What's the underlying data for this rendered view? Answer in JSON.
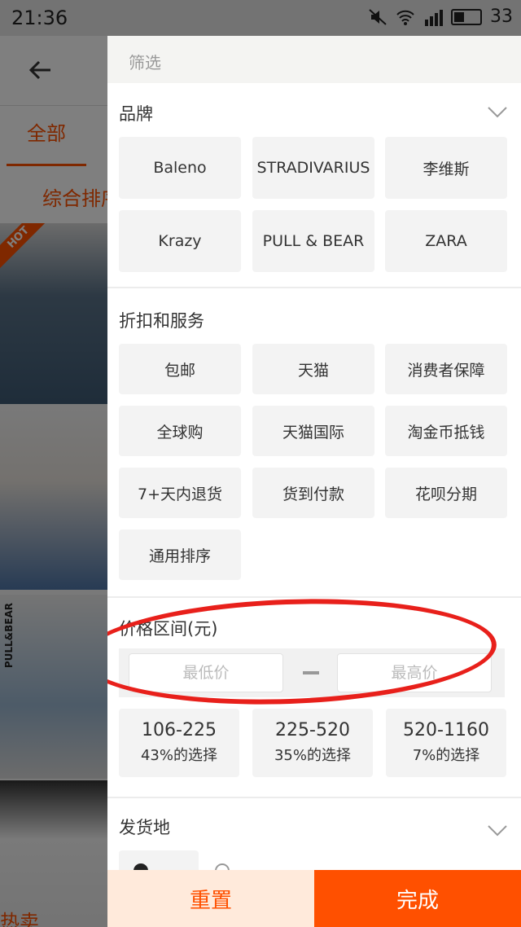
{
  "status_bar": {
    "time": "21:36",
    "battery": "33"
  },
  "background": {
    "tab_all": "全部",
    "sort_label": "综合排序",
    "hot_badge": "HOT",
    "pullbear_logo": "PULL&BEAR",
    "bottom_partial": "热卖"
  },
  "filter": {
    "title": "筛选",
    "brand": {
      "title": "品牌",
      "items": [
        "Baleno",
        "STRADIVARIUS",
        "李维斯",
        "Krazy",
        "PULL & BEAR",
        "ZARA"
      ]
    },
    "services": {
      "title": "折扣和服务",
      "items": [
        "包邮",
        "天猫",
        "消费者保障",
        "全球购",
        "天猫国际",
        "淘金币抵钱",
        "7+天内退货",
        "货到付款",
        "花呗分期",
        "通用排序"
      ]
    },
    "price": {
      "title": "价格区间(元)",
      "min_placeholder": "最低价",
      "max_placeholder": "最高价",
      "ranges": [
        {
          "value": "106-225",
          "pct": "43%的选择"
        },
        {
          "value": "225-520",
          "pct": "35%的选择"
        },
        {
          "value": "520-1160",
          "pct": "7%的选择"
        }
      ]
    },
    "origin": {
      "title": "发货地"
    },
    "reset_label": "重置",
    "done_label": "完成"
  },
  "colors": {
    "accent": "#ff5000",
    "annotation": "#e8201b"
  },
  "icons": [
    "back-arrow-icon",
    "chevron-down-icon",
    "mute-icon",
    "wifi-icon",
    "signal-icon",
    "battery-icon"
  ]
}
